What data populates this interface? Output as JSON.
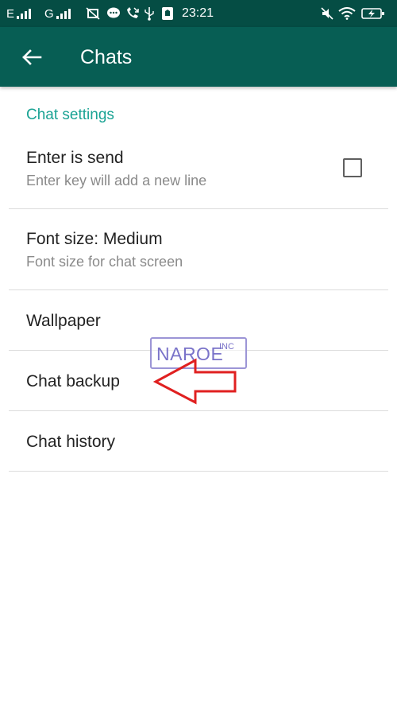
{
  "status_bar": {
    "carrier_1": "E",
    "carrier_2": "G",
    "time": "23:21",
    "icons": [
      "signal-icon",
      "signal-icon",
      "screenshot-icon",
      "chat-bubble-icon",
      "missed-call-icon",
      "usb-icon",
      "android-debug-icon",
      "mute-icon",
      "wifi-icon",
      "battery-charging-icon"
    ]
  },
  "app_bar": {
    "title": "Chats",
    "back_icon": "arrow-left-icon",
    "color": "#075e54"
  },
  "section_header": "Chat settings",
  "settings": [
    {
      "title": "Enter is send",
      "subtitle": "Enter key will add a new line",
      "checked": false
    },
    {
      "title": "Font size: Medium",
      "subtitle": "Font size for chat screen"
    },
    {
      "title": "Wallpaper"
    },
    {
      "title": "Chat backup"
    },
    {
      "title": "Chat history"
    }
  ],
  "watermark": {
    "text": "NAROE",
    "suffix": "INC"
  },
  "accent_color": "#1aa394"
}
